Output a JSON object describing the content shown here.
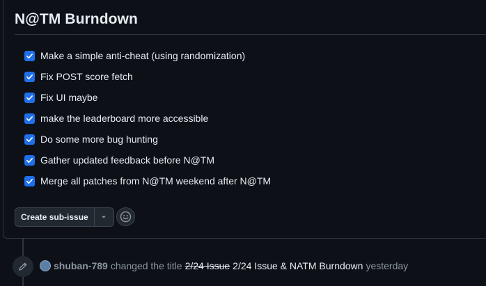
{
  "comment": {
    "heading": "N@TM Burndown",
    "tasks": [
      {
        "label": "Make a simple anti-cheat (using randomization)",
        "checked": true
      },
      {
        "label": "Fix POST score fetch",
        "checked": true
      },
      {
        "label": "Fix UI maybe",
        "checked": true
      },
      {
        "label": "make the leaderboard more accessible",
        "checked": true
      },
      {
        "label": "Do some more bug hunting",
        "checked": true
      },
      {
        "label": "Gather updated feedback before N@TM",
        "checked": true
      },
      {
        "label": "Merge all patches from N@TM weekend after N@TM",
        "checked": true
      }
    ],
    "create_sub_issue_label": "Create sub-issue",
    "accent_color": "#1f6feb"
  },
  "event": {
    "author": "shuban-789",
    "action": "changed the title",
    "old_title": "2/24 Issue",
    "new_title": "2/24 Issue & NATM Burndown",
    "time": "yesterday"
  }
}
